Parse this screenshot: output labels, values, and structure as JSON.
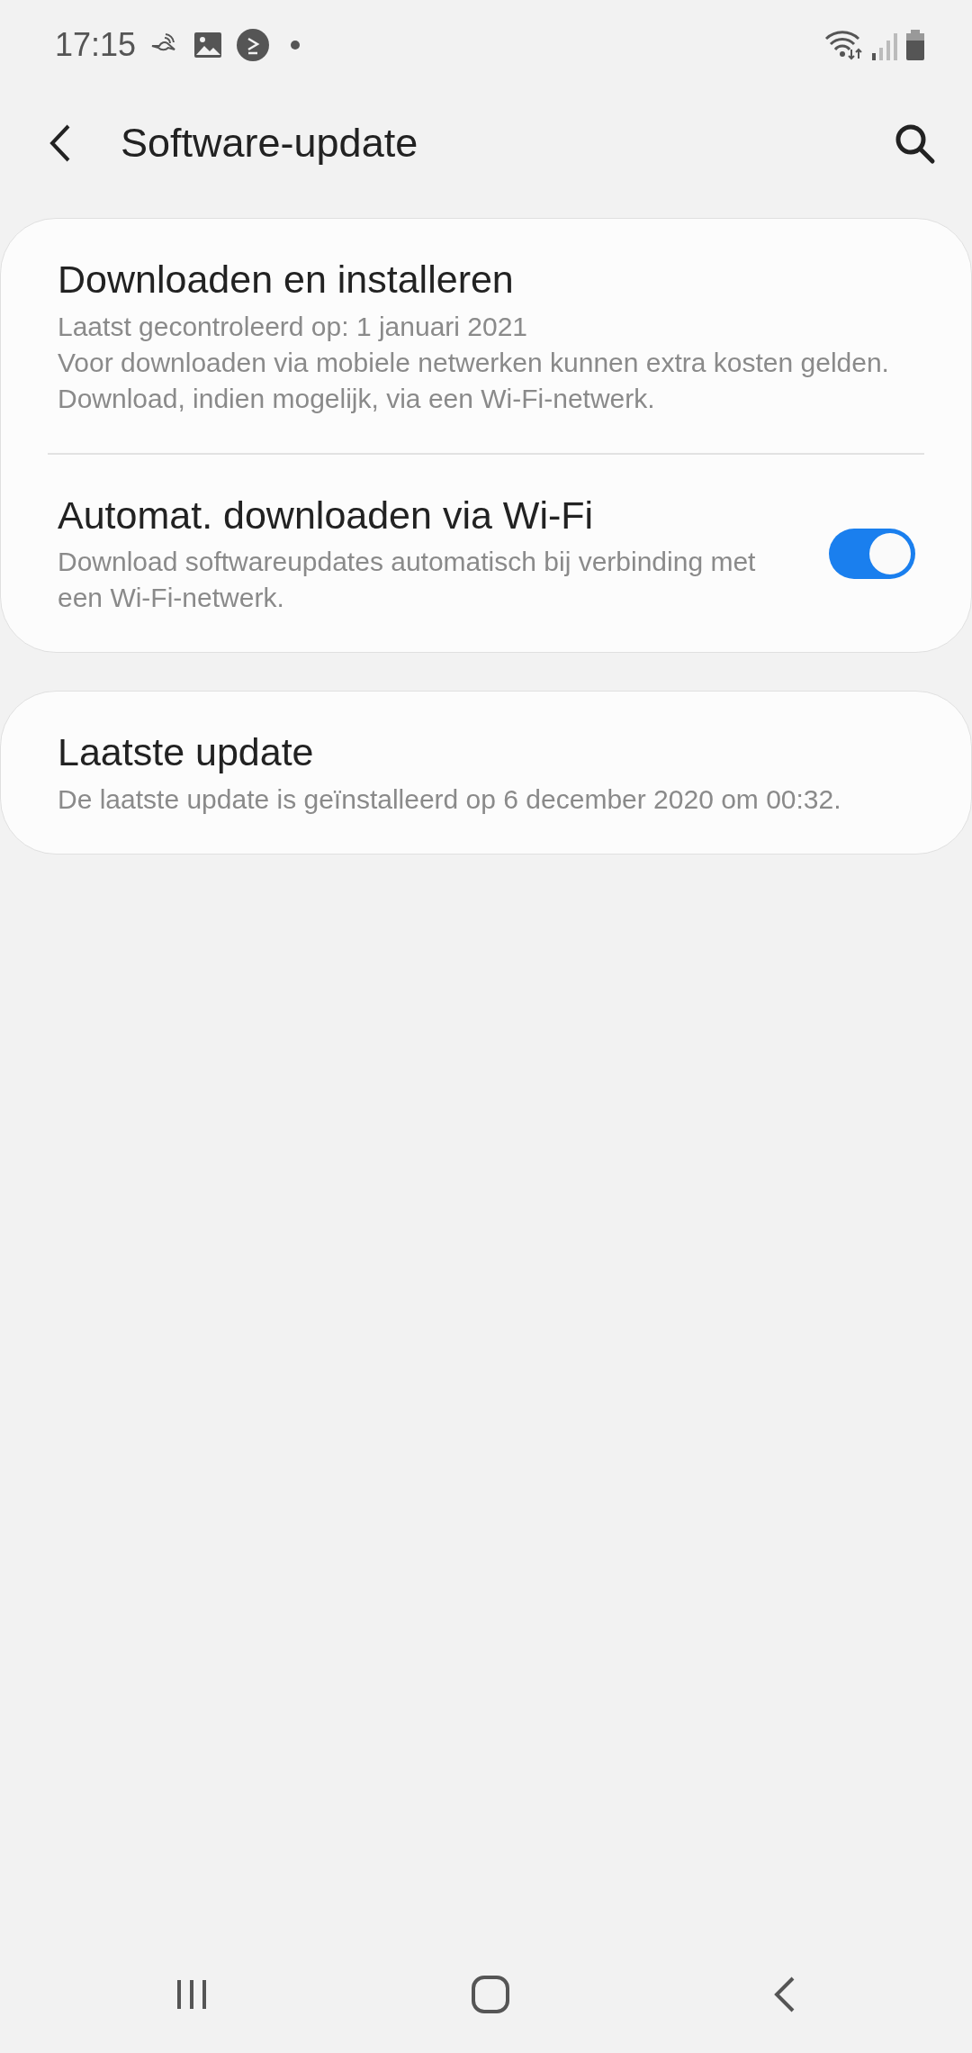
{
  "status_bar": {
    "time": "17:15"
  },
  "app_bar": {
    "title": "Software-update"
  },
  "cards": [
    {
      "items": [
        {
          "kind": "text",
          "title": "Downloaden en installeren",
          "descriptions": [
            "Laatst gecontroleerd op: 1 januari 2021",
            "Voor downloaden via mobiele netwerken kunnen extra kosten gelden. Download, indien mogelijk, via een Wi-Fi-netwerk."
          ]
        },
        {
          "kind": "switch",
          "title": "Automat. downloaden via Wi-Fi",
          "descriptions": [
            "Download softwareupdates automatisch bij verbinding met een Wi-Fi-netwerk."
          ],
          "on": true
        }
      ]
    },
    {
      "items": [
        {
          "kind": "text",
          "title": "Laatste update",
          "descriptions": [
            "De laatste update is geïnstalleerd op 6 december 2020 om 00:32."
          ]
        }
      ]
    }
  ]
}
